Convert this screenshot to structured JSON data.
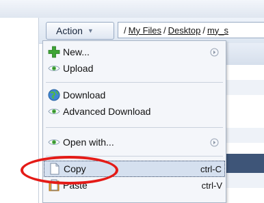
{
  "toolbar": {
    "action_label": "Action",
    "path": [
      {
        "sep": "/",
        "label": "My Files"
      },
      {
        "sep": "/",
        "label": "Desktop"
      },
      {
        "sep": "/",
        "label": "my_s"
      }
    ]
  },
  "context_menu": {
    "items": [
      {
        "label": "New...",
        "icon": "plus-icon",
        "submenu": true
      },
      {
        "label": "Upload",
        "icon": "eye-icon"
      },
      {
        "label": "Download",
        "icon": "globe-icon"
      },
      {
        "label": "Advanced Download",
        "icon": "eye-icon"
      },
      {
        "label": "Open with...",
        "icon": "eye-icon",
        "submenu": true
      },
      {
        "label": "Copy",
        "icon": "copy-icon",
        "shortcut": "ctrl-C",
        "highlighted": true
      },
      {
        "label": "Paste",
        "icon": "paste-icon",
        "shortcut": "ctrl-V"
      }
    ]
  },
  "annotation": {
    "color": "#e41b17",
    "target": "Copy"
  }
}
